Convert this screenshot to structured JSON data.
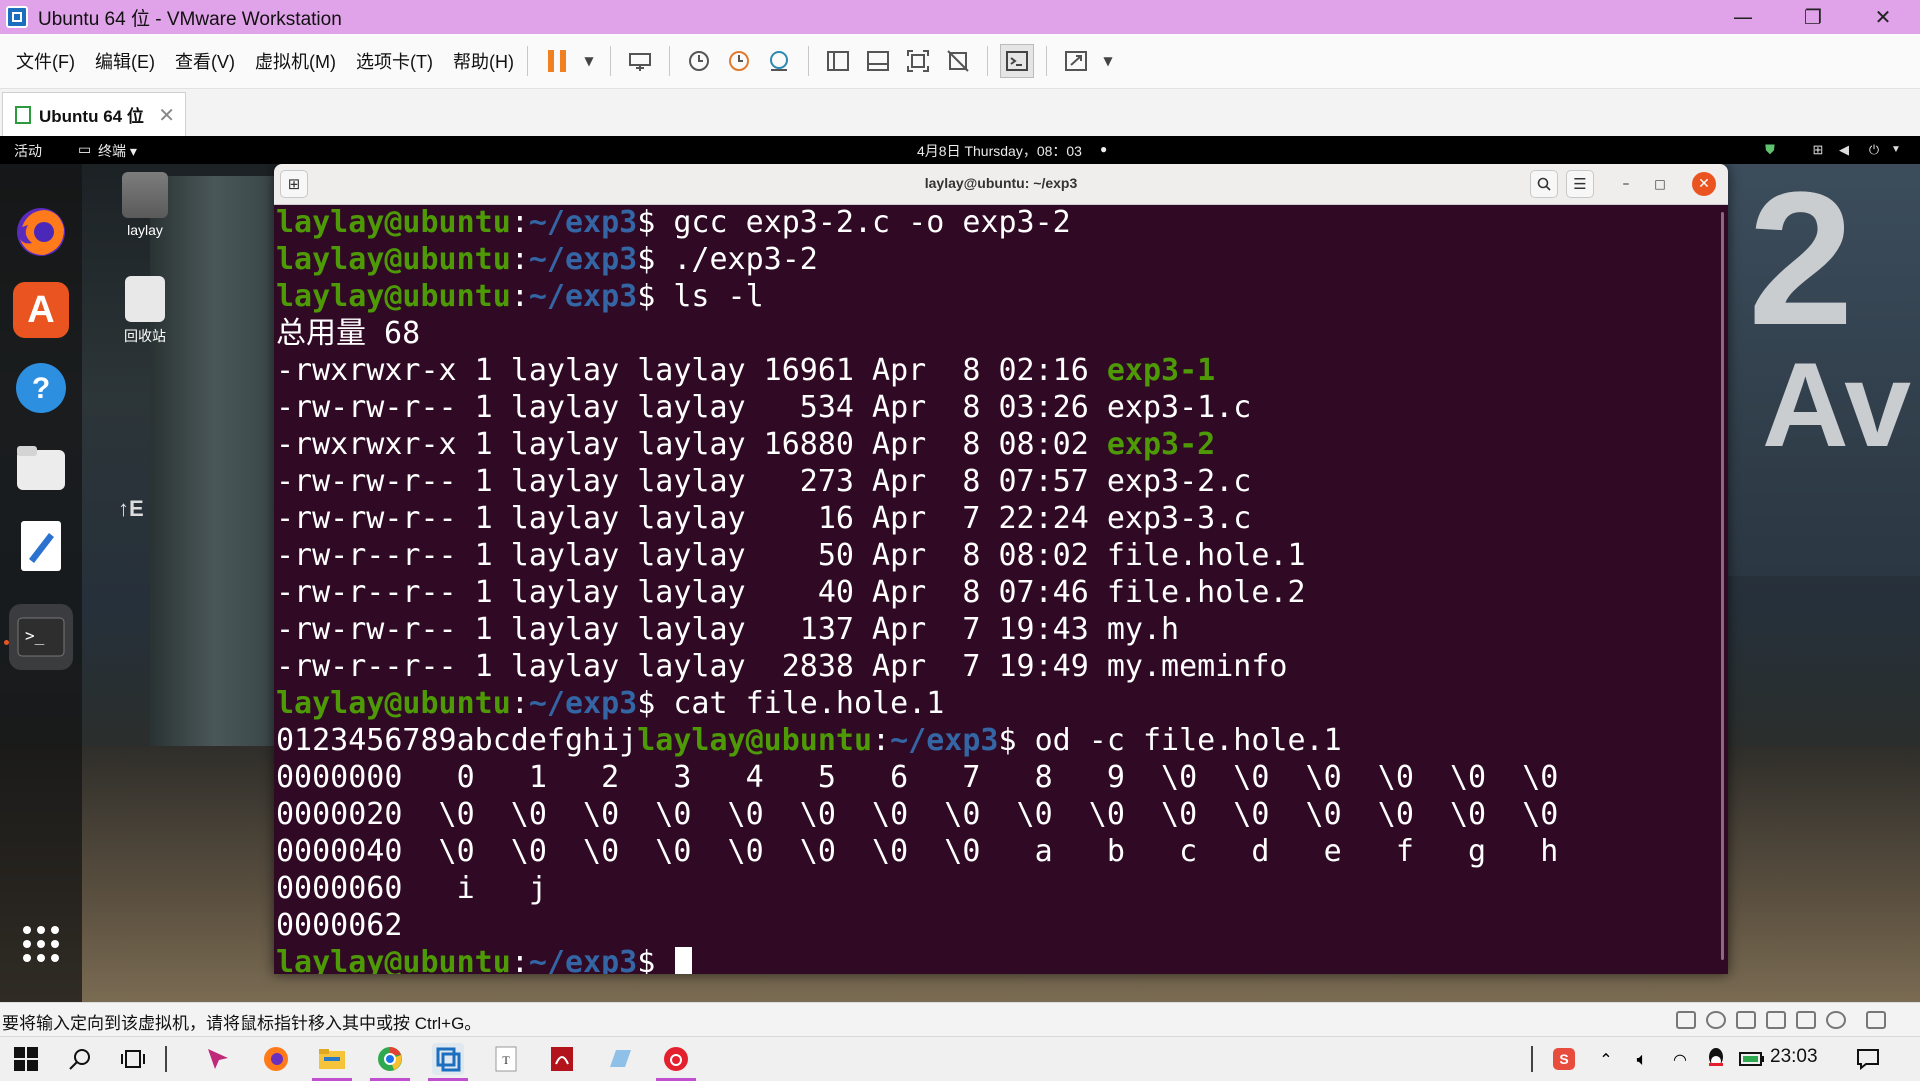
{
  "window": {
    "title": "Ubuntu 64 位 - VMware Workstation",
    "controls": [
      "minimize",
      "restore",
      "close"
    ]
  },
  "menu": {
    "items": [
      "文件(F)",
      "编辑(E)",
      "查看(V)",
      "虚拟机(M)",
      "选项卡(T)",
      "帮助(H)"
    ]
  },
  "tab": {
    "label": "Ubuntu 64 位"
  },
  "gnome": {
    "activities": "活动",
    "app_menu": "终端 ▾",
    "clock": "4月8日 Thursday，08：03",
    "desktop_icons": [
      "laylay",
      "回收站"
    ]
  },
  "background_sign": {
    "line1": "2",
    "line2": "Av",
    "small": "↑E"
  },
  "terminal": {
    "title": "laylay@ubuntu: ~/exp3",
    "prompt_user": "laylay@ubuntu",
    "prompt_colon": ":",
    "prompt_path": "~/exp3",
    "prompt_dollar": "$ ",
    "lines": [
      {
        "type": "cmd",
        "text": "gcc exp3-2.c -o exp3-2"
      },
      {
        "type": "cmd",
        "text": "./exp3-2"
      },
      {
        "type": "cmd",
        "text": "ls -l"
      },
      {
        "type": "out",
        "text": "总用量 68"
      },
      {
        "type": "file",
        "prefix": "-rwxrwxr-x 1 laylay laylay 16961 Apr  8 02:16 ",
        "name": "exp3-1",
        "exe": true
      },
      {
        "type": "file",
        "prefix": "-rw-rw-r-- 1 laylay laylay   534 Apr  8 03:26 ",
        "name": "exp3-1.c",
        "exe": false
      },
      {
        "type": "file",
        "prefix": "-rwxrwxr-x 1 laylay laylay 16880 Apr  8 08:02 ",
        "name": "exp3-2",
        "exe": true
      },
      {
        "type": "file",
        "prefix": "-rw-rw-r-- 1 laylay laylay   273 Apr  8 07:57 ",
        "name": "exp3-2.c",
        "exe": false
      },
      {
        "type": "file",
        "prefix": "-rw-rw-r-- 1 laylay laylay    16 Apr  7 22:24 ",
        "name": "exp3-3.c",
        "exe": false
      },
      {
        "type": "file",
        "prefix": "-rw-r--r-- 1 laylay laylay    50 Apr  8 08:02 ",
        "name": "file.hole.1",
        "exe": false
      },
      {
        "type": "file",
        "prefix": "-rw-r--r-- 1 laylay laylay    40 Apr  8 07:46 ",
        "name": "file.hole.2",
        "exe": false
      },
      {
        "type": "file",
        "prefix": "-rw-rw-r-- 1 laylay laylay   137 Apr  7 19:43 ",
        "name": "my.h",
        "exe": false
      },
      {
        "type": "file",
        "prefix": "-rw-r--r-- 1 laylay laylay  2838 Apr  7 19:49 ",
        "name": "my.meminfo",
        "exe": false
      },
      {
        "type": "cmd",
        "text": "cat file.hole.1"
      },
      {
        "type": "outcmd",
        "pre": "0123456789abcdefghij",
        "text": "od -c file.hole.1"
      },
      {
        "type": "out",
        "text": "0000000   0   1   2   3   4   5   6   7   8   9  \\0  \\0  \\0  \\0  \\0  \\0"
      },
      {
        "type": "out",
        "text": "0000020  \\0  \\0  \\0  \\0  \\0  \\0  \\0  \\0  \\0  \\0  \\0  \\0  \\0  \\0  \\0  \\0"
      },
      {
        "type": "out",
        "text": "0000040  \\0  \\0  \\0  \\0  \\0  \\0  \\0  \\0   a   b   c   d   e   f   g   h"
      },
      {
        "type": "out",
        "text": "0000060   i   j"
      },
      {
        "type": "out",
        "text": "0000062"
      },
      {
        "type": "prompt",
        "text": ""
      }
    ]
  },
  "statusbar": {
    "text": "要将输入定向到该虚拟机，请将鼠标指针移入其中或按 Ctrl+G。"
  },
  "taskbar": {
    "time": "23:03"
  },
  "colors": {
    "terminal_bg": "#300a24",
    "prompt_user": "#4e9a06",
    "prompt_path": "#3465a4",
    "title_bar": "#e0a2e8",
    "accent_orange": "#e95420"
  }
}
